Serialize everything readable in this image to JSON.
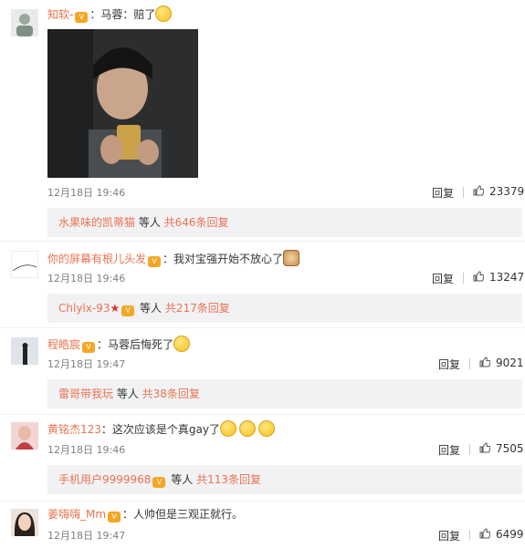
{
  "comments": [
    {
      "user": "知软-",
      "text": "：马蓉：赔了",
      "time": "12月18日 19:46",
      "reply_label": "回复",
      "likes": "23379",
      "thread": {
        "who": "水果味的凯蒂猫",
        "mid": " 等人 ",
        "count": "共646条回复"
      }
    },
    {
      "user": "你的屏幕有根儿头发",
      "text": "：我对宝强开始不放心了",
      "time": "12月18日 19:46",
      "reply_label": "回复",
      "likes": "13247",
      "thread": {
        "who": "Chlylx-93",
        "mid": " 等人 ",
        "count": "共217条回复"
      }
    },
    {
      "user": "程皓宸",
      "text": "：马蓉后悔死了",
      "time": "12月18日 19:47",
      "reply_label": "回复",
      "likes": "9021",
      "thread": {
        "who": "雷哥带我玩",
        "mid": " 等人 ",
        "count": "共38条回复"
      }
    },
    {
      "user": "黄铭杰123",
      "text": "：这次应该是个真gay了",
      "time": "12月18日 19:46",
      "reply_label": "回复",
      "likes": "7505",
      "thread": {
        "who": "手机用户9999968",
        "mid": " 等人 ",
        "count": "共113条回复"
      }
    },
    {
      "user": "姜嗨嗨_Mm",
      "text": "：人帅但是三观正就行。",
      "time": "12月18日 19:47",
      "reply_label": "回复",
      "likes": "6499"
    }
  ]
}
